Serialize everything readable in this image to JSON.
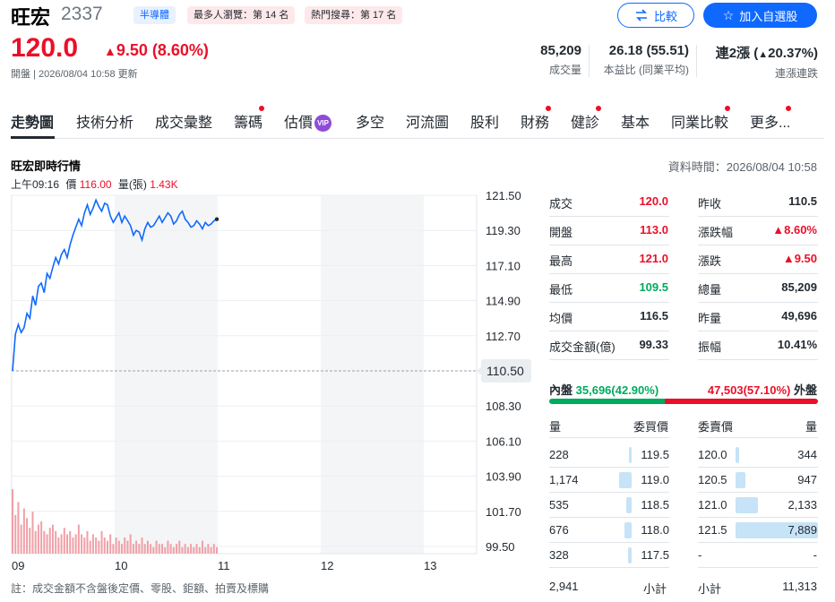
{
  "header": {
    "name": "旺宏",
    "code": "2337",
    "tags": [
      "半導體",
      "最多人瀏覽：第 14 名",
      "熱門搜尋：第 17 名"
    ],
    "compare_label": "比較",
    "watchlist_label": "加入自選股",
    "price": "120.0",
    "change": "9.50 (8.60%)",
    "open_time": "開盤 | 2026/08/04 10:58 更新"
  },
  "kpis": [
    {
      "value": "85,209",
      "label": "成交量"
    },
    {
      "value": "26.18 (55.51)",
      "label": "本益比 (同業平均)"
    },
    {
      "value_prefix": "連2漲 (",
      "value_pct": "20.37%",
      "value_suffix": ")",
      "label": "連漲連跌"
    }
  ],
  "tabs": [
    "走勢圖",
    "技術分析",
    "成交彙整",
    "籌碼",
    "估價",
    "多空",
    "河流圖",
    "股利",
    "財務",
    "健診",
    "基本",
    "同業比較",
    "更多..."
  ],
  "vip_label": "VIP",
  "panel": {
    "title": "旺宏即時行情",
    "data_time": "資料時間：2026/08/04 10:58",
    "legend_time": "上午09:16",
    "legend_price_label": "價",
    "legend_price": "116.00",
    "legend_vol_label": "量(張)",
    "legend_vol": "1.43K"
  },
  "chart_data": {
    "type": "line",
    "x_ticks": [
      "09",
      "10",
      "11",
      "12",
      "13"
    ],
    "y_ticks": [
      "121.50",
      "119.30",
      "117.10",
      "114.90",
      "112.70",
      "108.30",
      "106.10",
      "103.90",
      "101.70",
      "99.50"
    ],
    "reference_label": "110.50",
    "reference_value": 110.5,
    "ylim": [
      99.5,
      121.5
    ],
    "price_series": [
      110.5,
      112.8,
      113.4,
      112.9,
      113.2,
      114.1,
      113.8,
      115.2,
      114.6,
      115.8,
      116.0,
      115.4,
      116.6,
      116.3,
      117.0,
      117.6,
      117.2,
      117.8,
      118.1,
      117.6,
      118.4,
      119.0,
      119.5,
      120.0,
      119.6,
      120.4,
      120.9,
      120.3,
      120.7,
      121.2,
      120.8,
      120.5,
      121.0,
      120.9,
      120.2,
      119.8,
      120.1,
      120.4,
      119.8,
      120.2,
      119.9,
      119.6,
      119.0,
      119.3,
      119.2,
      118.7,
      119.4,
      119.8,
      119.5,
      119.6,
      119.9,
      120.2,
      119.8,
      120.1,
      120.4,
      120.2,
      119.7,
      119.9,
      120.3,
      120.5,
      120.0,
      119.8,
      119.5,
      119.6,
      119.9,
      119.7,
      119.4,
      119.8,
      119.6,
      119.7,
      119.9,
      120.0
    ],
    "volume_series": [
      20,
      12,
      16,
      9,
      14,
      11,
      8,
      13,
      7,
      9,
      10,
      7,
      6,
      8,
      9,
      7,
      5,
      6,
      8,
      6,
      7,
      5,
      6,
      9,
      6,
      5,
      7,
      4,
      6,
      5,
      4,
      7,
      5,
      4,
      6,
      3,
      5,
      4,
      3,
      5,
      4,
      6,
      3,
      4,
      3,
      5,
      3,
      4,
      3,
      2,
      4,
      3,
      3,
      2,
      4,
      3,
      2,
      3,
      4,
      2,
      3,
      2,
      3,
      2,
      3,
      2,
      4,
      2,
      3,
      2,
      3,
      2
    ]
  },
  "quote": {
    "left": [
      {
        "label": "成交",
        "value": "120.0",
        "cls": "up"
      },
      {
        "label": "開盤",
        "value": "113.0",
        "cls": "up"
      },
      {
        "label": "最高",
        "value": "121.0",
        "cls": "up"
      },
      {
        "label": "最低",
        "value": "109.5",
        "cls": "dn"
      },
      {
        "label": "均價",
        "value": "116.5",
        "cls": ""
      },
      {
        "label": "成交金額(億)",
        "value": "99.33",
        "cls": ""
      }
    ],
    "right": [
      {
        "label": "昨收",
        "value": "110.5",
        "cls": ""
      },
      {
        "label": "漲跌幅",
        "value": "▲8.60%",
        "cls": "up"
      },
      {
        "label": "漲跌",
        "value": "▲9.50",
        "cls": "up"
      },
      {
        "label": "總量",
        "value": "85,209",
        "cls": ""
      },
      {
        "label": "昨量",
        "value": "49,696",
        "cls": ""
      },
      {
        "label": "振幅",
        "value": "10.41%",
        "cls": ""
      }
    ]
  },
  "inout": {
    "in_label": "內盤",
    "in_value": "35,696(42.90%)",
    "in_ratio": 0.429,
    "out_value": "47,503(57.10%)",
    "out_label": "外盤"
  },
  "orderbook": {
    "headers": {
      "bid_qty": "量",
      "bid_price": "委買價",
      "ask_price": "委賣價",
      "ask_qty": "量"
    },
    "rows": [
      {
        "bq": "228",
        "bp": "119.5",
        "ap": "120.0",
        "aq": "344",
        "bqv": 228,
        "aqv": 344
      },
      {
        "bq": "1,174",
        "bp": "119.0",
        "ap": "120.5",
        "aq": "947",
        "bqv": 1174,
        "aqv": 947
      },
      {
        "bq": "535",
        "bp": "118.5",
        "ap": "121.0",
        "aq": "2,133",
        "bqv": 535,
        "aqv": 2133
      },
      {
        "bq": "676",
        "bp": "118.0",
        "ap": "121.5",
        "aq": "7,889",
        "bqv": 676,
        "aqv": 7889
      },
      {
        "bq": "328",
        "bp": "117.5",
        "ap": "-",
        "aq": "-",
        "bqv": 328,
        "aqv": 0
      }
    ],
    "bid_total": "2,941",
    "bid_total_label": "小計",
    "ask_total_label": "小計",
    "ask_total": "11,313"
  },
  "note": "註：成交金額不含盤後定價、零股、鉅額、拍賣及標購",
  "colors": {
    "up": "#eb0f29",
    "down": "#00ab5e",
    "line": "#0f69ff",
    "accent": "#0f69ff"
  }
}
